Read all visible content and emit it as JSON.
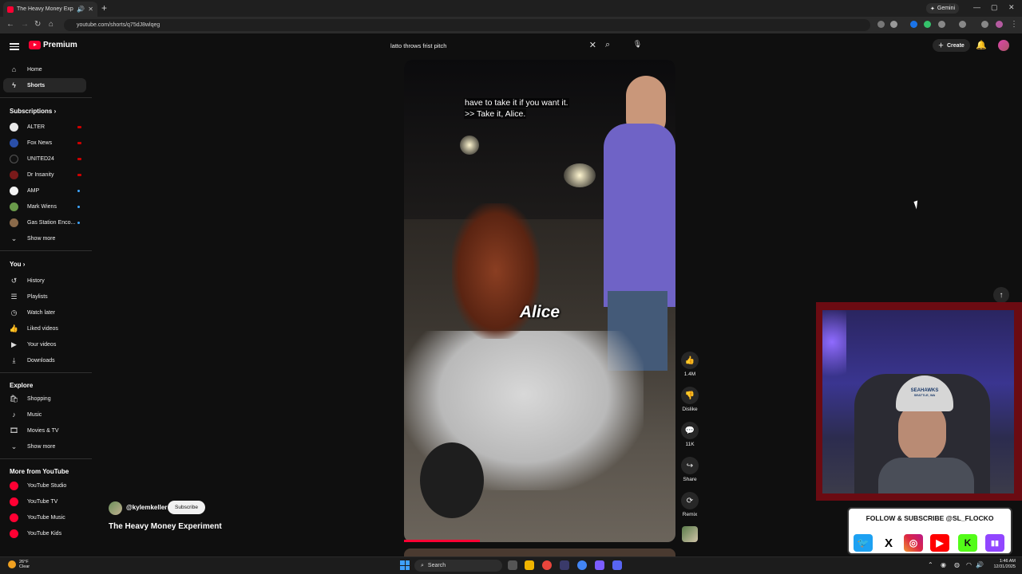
{
  "browser": {
    "tab_title": "The Heavy Money Experime",
    "new_tab": "+",
    "gemini_label": "Gemini",
    "url": "youtube.com/shorts/q75dJ8wlqeg",
    "win_minimize": "—",
    "win_maximize": "▢",
    "win_close": "✕"
  },
  "header": {
    "logo_text": "Premium",
    "search_value": "latto throws frist pitch",
    "create_label": "Create"
  },
  "sidebar": {
    "main": [
      {
        "label": "Home",
        "icon": "home-icon"
      },
      {
        "label": "Shorts",
        "icon": "shorts-icon"
      }
    ],
    "subscriptions_heading": "Subscriptions",
    "subscriptions": [
      {
        "label": "ALTER",
        "status": "live",
        "avatar_color": "#e8e8e8"
      },
      {
        "label": "Fox News",
        "status": "live",
        "avatar_color": "#2a4fa8"
      },
      {
        "label": "UNITED24",
        "status": "live",
        "avatar_color": "#111111"
      },
      {
        "label": "Dr Insanity",
        "status": "live",
        "avatar_color": "#7a1a1a"
      },
      {
        "label": "AMP",
        "status": "new",
        "avatar_color": "#f2f2f2"
      },
      {
        "label": "Mark Wiens",
        "status": "new",
        "avatar_color": "#6a9a4a"
      },
      {
        "label": "Gas Station Enco...",
        "status": "new",
        "avatar_color": "#8a6a4a"
      }
    ],
    "show_more_1": "Show more",
    "you_heading": "You",
    "you": [
      {
        "label": "History",
        "icon": "history-icon"
      },
      {
        "label": "Playlists",
        "icon": "playlists-icon"
      },
      {
        "label": "Watch later",
        "icon": "watch-later-icon"
      },
      {
        "label": "Liked videos",
        "icon": "liked-videos-icon"
      },
      {
        "label": "Your videos",
        "icon": "your-videos-icon"
      },
      {
        "label": "Downloads",
        "icon": "downloads-icon"
      }
    ],
    "explore_heading": "Explore",
    "explore": [
      {
        "label": "Shopping",
        "icon": "shopping-icon"
      },
      {
        "label": "Music",
        "icon": "music-icon"
      },
      {
        "label": "Movies & TV",
        "icon": "movies-icon"
      }
    ],
    "show_more_2": "Show more",
    "more_heading": "More from YouTube",
    "more": [
      {
        "label": "YouTube Studio"
      },
      {
        "label": "YouTube TV"
      },
      {
        "label": "YouTube Music"
      },
      {
        "label": "YouTube Kids"
      }
    ]
  },
  "video": {
    "caption_line1": "have to take it if you want it.",
    "caption_line2": ">> Take it, Alice.",
    "overlay_text": "Alice",
    "progress": 0.28,
    "channel": "@kylemkeller",
    "subscribe_label": "Subscribe",
    "title": "The Heavy Money Experiment"
  },
  "actions": {
    "like_count": "1.4M",
    "dislike_label": "Dislike",
    "comments_count": "11K",
    "share_label": "Share",
    "remix_label": "Remix"
  },
  "stream_overlay": {
    "hat_text": "SEAHAWKS",
    "hat_subtext": "SEATTLE, WA",
    "follow_text": "FOLLOW & SUBSCRIBE @SL_FLOCKO",
    "socials": [
      {
        "name": "twitter-icon",
        "glyph": "🐦",
        "color": "#1da1f2"
      },
      {
        "name": "x-icon",
        "glyph": "X",
        "color": "#ffffff"
      },
      {
        "name": "instagram-icon",
        "glyph": "◎",
        "color": "#d6249f"
      },
      {
        "name": "youtube-icon",
        "glyph": "▶",
        "color": "#ff0000"
      },
      {
        "name": "kick-icon",
        "glyph": "K",
        "color": "#53fc18"
      },
      {
        "name": "twitch-icon",
        "glyph": "▮▮",
        "color": "#9146ff"
      }
    ]
  },
  "taskbar": {
    "temperature": "26°F",
    "weather": "Clear",
    "search_label": "Search",
    "time": "1:46 AM",
    "date": "12/31/2025"
  },
  "colors": {
    "brand": "#ff0033",
    "background": "#0f0f0f",
    "accent_blue": "#3ea6ff",
    "webcam_frame": "#6b0b12"
  }
}
